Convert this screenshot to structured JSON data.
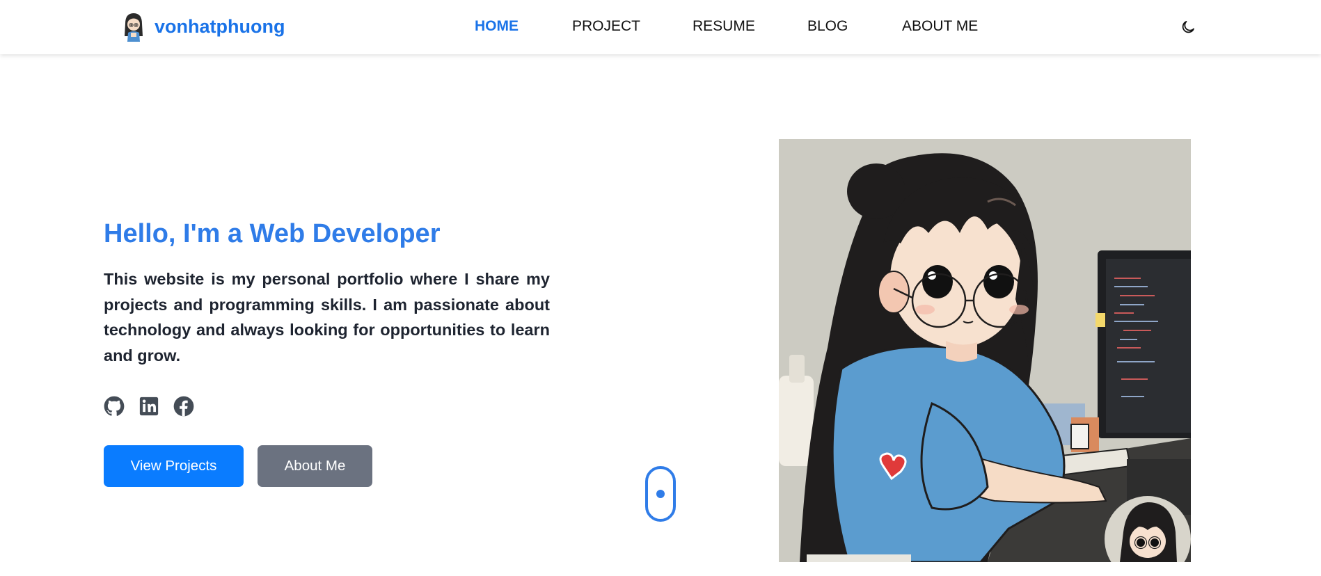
{
  "navbar": {
    "brand_name": "vonhatphuong",
    "links": [
      {
        "label": "HOME",
        "active": true
      },
      {
        "label": "PROJECT",
        "active": false
      },
      {
        "label": "RESUME",
        "active": false
      },
      {
        "label": "BLOG",
        "active": false
      },
      {
        "label": "ABOUT ME",
        "active": false
      }
    ],
    "theme_icon": "moon-icon"
  },
  "hero": {
    "title": "Hello, I'm a Web Developer",
    "description": "This website is my personal portfolio where I share my projects and programming skills. I am passionate about technology and always looking for opportunities to learn and grow.",
    "socials": [
      "github-icon",
      "linkedin-icon",
      "facebook-icon"
    ],
    "primary_button": "View Projects",
    "secondary_button": "About Me",
    "scroll_icon": "mouse-scroll-icon"
  },
  "colors": {
    "accent": "#1a73e8",
    "title": "#2f7ce8",
    "primary_button": "#0a7cff",
    "secondary_button": "#6b7280",
    "text": "#1e2430"
  }
}
